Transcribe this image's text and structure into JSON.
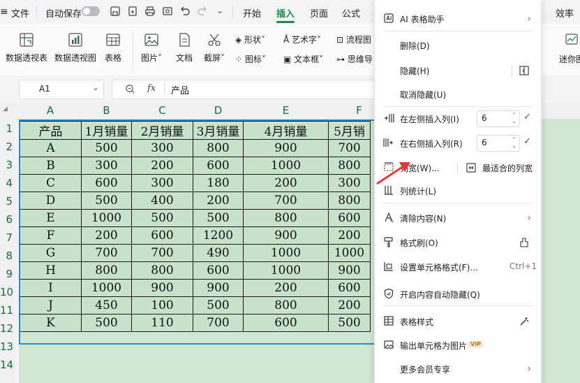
{
  "menubar": {
    "file": "文件",
    "autosave": "自动保存",
    "tabs": [
      "开始",
      "插入",
      "页面",
      "公式"
    ],
    "active_tab": "插入",
    "right_tab": "效率"
  },
  "ribbon": {
    "pivot_table": "数据透视表",
    "pivot_chart": "数据透视图",
    "table": "表格",
    "picture": "图片",
    "document": "文档",
    "screenshot": "截屏",
    "shape": "形状",
    "icon": "图标",
    "art_text": "艺术字",
    "text_box": "文本框",
    "flowchart": "流程图",
    "mindmap": "思维导",
    "mini_chart": "迷你图"
  },
  "formula_bar": {
    "cell_ref": "A1",
    "fx": "fx",
    "content": "产品"
  },
  "grid": {
    "col_headers": [
      "A",
      "B",
      "C",
      "D",
      "E",
      "F"
    ],
    "row_headers": [
      "1",
      "2",
      "3",
      "4",
      "5",
      "6",
      "7",
      "8",
      "9",
      "10",
      "11",
      "12",
      "13",
      "14"
    ],
    "header_row": [
      "产品",
      "1月销量",
      "2月销量",
      "3月销量",
      "4月销量",
      "5月销"
    ],
    "rows": [
      [
        "A",
        "500",
        "300",
        "800",
        "900",
        "700"
      ],
      [
        "B",
        "300",
        "200",
        "600",
        "1000",
        "800"
      ],
      [
        "C",
        "600",
        "300",
        "180",
        "200",
        "300"
      ],
      [
        "D",
        "500",
        "400",
        "200",
        "700",
        "800"
      ],
      [
        "E",
        "1000",
        "500",
        "500",
        "800",
        "600"
      ],
      [
        "F",
        "200",
        "600",
        "1200",
        "900",
        "200"
      ],
      [
        "G",
        "700",
        "700",
        "490",
        "1000",
        "1000"
      ],
      [
        "H",
        "800",
        "800",
        "600",
        "1000",
        "900"
      ],
      [
        "I",
        "1000",
        "900",
        "900",
        "200",
        "600"
      ],
      [
        "J",
        "450",
        "100",
        "500",
        "800",
        "200"
      ],
      [
        "K",
        "500",
        "110",
        "700",
        "600",
        "500"
      ]
    ]
  },
  "context_menu": {
    "ai_assistant": "AI 表格助手",
    "delete": "删除(D)",
    "hide": "隐藏(H)",
    "unhide": "取消隐藏(U)",
    "insert_left": "在左侧插入列(I)",
    "insert_left_value": "6",
    "insert_right": "在右侧插入列(R)",
    "insert_right_value": "6",
    "col_width": "列宽(W)...",
    "best_fit": "最适合的列宽",
    "col_stats": "列统计(L)",
    "clear": "清除内容(N)",
    "format_painter": "格式刷(O)",
    "format_cells": "设置单元格格式(F)...",
    "format_cells_shortcut": "Ctrl+1",
    "auto_hide": "开启内容自动隐藏(Q)",
    "table_style": "表格样式",
    "export_image": "输出单元格为图片",
    "vip_badge": "VIP",
    "more_member": "更多会员专享"
  },
  "colors": {
    "selection_border": "#2b8ad6",
    "cell_fill": "#c9e2cc",
    "accent_green": "#1c8a4a",
    "arrow_red": "#e53935"
  }
}
